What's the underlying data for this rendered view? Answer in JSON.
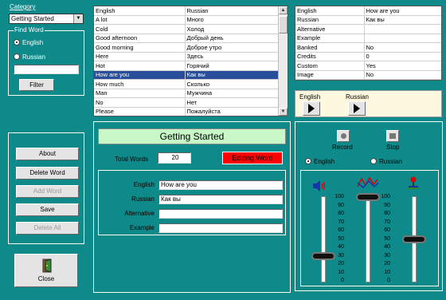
{
  "category": {
    "label": "Category",
    "value": "Getting Started"
  },
  "find_word": {
    "label": "Find Word",
    "options": [
      "English",
      "Russian"
    ],
    "selected": "English",
    "filter_label": "Filter"
  },
  "actions": {
    "about": "About",
    "delete_word": "Delete Word",
    "add_word": "Add Word",
    "save": "Save",
    "delete_all": "Delete All"
  },
  "close": {
    "label": "Close"
  },
  "word_list": {
    "headers": [
      "English",
      "Russian"
    ],
    "rows": [
      [
        "A lot",
        "Много"
      ],
      [
        "Cold",
        "Холод"
      ],
      [
        "Good afternoon",
        "Добрый день"
      ],
      [
        "Good morning",
        "Доброе утро"
      ],
      [
        "Here",
        "Здесь"
      ],
      [
        "Hot",
        "Горячий"
      ],
      [
        "How are you",
        "Как вы"
      ],
      [
        "How much",
        "Сколько"
      ],
      [
        "Man",
        "Мужчина"
      ],
      [
        "No",
        "Нет"
      ],
      [
        "Please",
        "Пожалуйста"
      ]
    ],
    "selected_index": 6
  },
  "details": {
    "rows": [
      [
        "English",
        "How are you"
      ],
      [
        "Russian",
        "Как вы"
      ],
      [
        "Alternative",
        ""
      ],
      [
        "Example",
        ""
      ],
      [
        "Banked",
        "No"
      ],
      [
        "Credits",
        "0"
      ],
      [
        "Custom",
        "Yes"
      ],
      [
        "Image",
        "No"
      ]
    ]
  },
  "play": {
    "english": "English",
    "russian": "Russian"
  },
  "editor": {
    "title": "Getting Started",
    "total_words_label": "Total Words",
    "total_words": "20",
    "status": "Editing Word",
    "status_color": "#ff0000",
    "fields": [
      {
        "label": "English",
        "value": "How are you"
      },
      {
        "label": "Russian",
        "value": "Как вы"
      },
      {
        "label": "Alternative",
        "value": ""
      },
      {
        "label": "Example",
        "value": ""
      }
    ]
  },
  "recorder": {
    "record": "Record",
    "stop": "Stop",
    "languages": [
      "English",
      "Russian"
    ],
    "selected_language": "English",
    "scale": [
      "100",
      "90",
      "80",
      "70",
      "60",
      "50",
      "40",
      "30",
      "20",
      "10",
      "0"
    ],
    "levels": {
      "volume": 30,
      "eq": 100,
      "mic": 50
    }
  },
  "colors": {
    "accent": "#0e8a8a",
    "title_bg": "#c8f7c8",
    "selection": "#2a4f9a"
  }
}
